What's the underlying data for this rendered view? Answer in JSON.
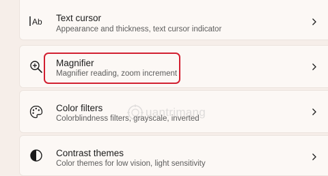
{
  "items": [
    {
      "title": "Text cursor",
      "description": "Appearance and thickness, text cursor indicator",
      "icon": "text-cursor-icon",
      "icon_text": "Ab"
    },
    {
      "title": "Magnifier",
      "description": "Magnifier reading, zoom increment",
      "icon": "magnifier-icon"
    },
    {
      "title": "Color filters",
      "description": "Colorblindness filters, grayscale, inverted",
      "icon": "color-palette-icon"
    },
    {
      "title": "Contrast themes",
      "description": "Color themes for low vision, light sensitivity",
      "icon": "contrast-icon"
    }
  ],
  "watermark": {
    "text": "uantrimang"
  },
  "colors": {
    "background": "#f6eee9",
    "card": "#fcf8f5",
    "highlight": "#d21e2f"
  }
}
